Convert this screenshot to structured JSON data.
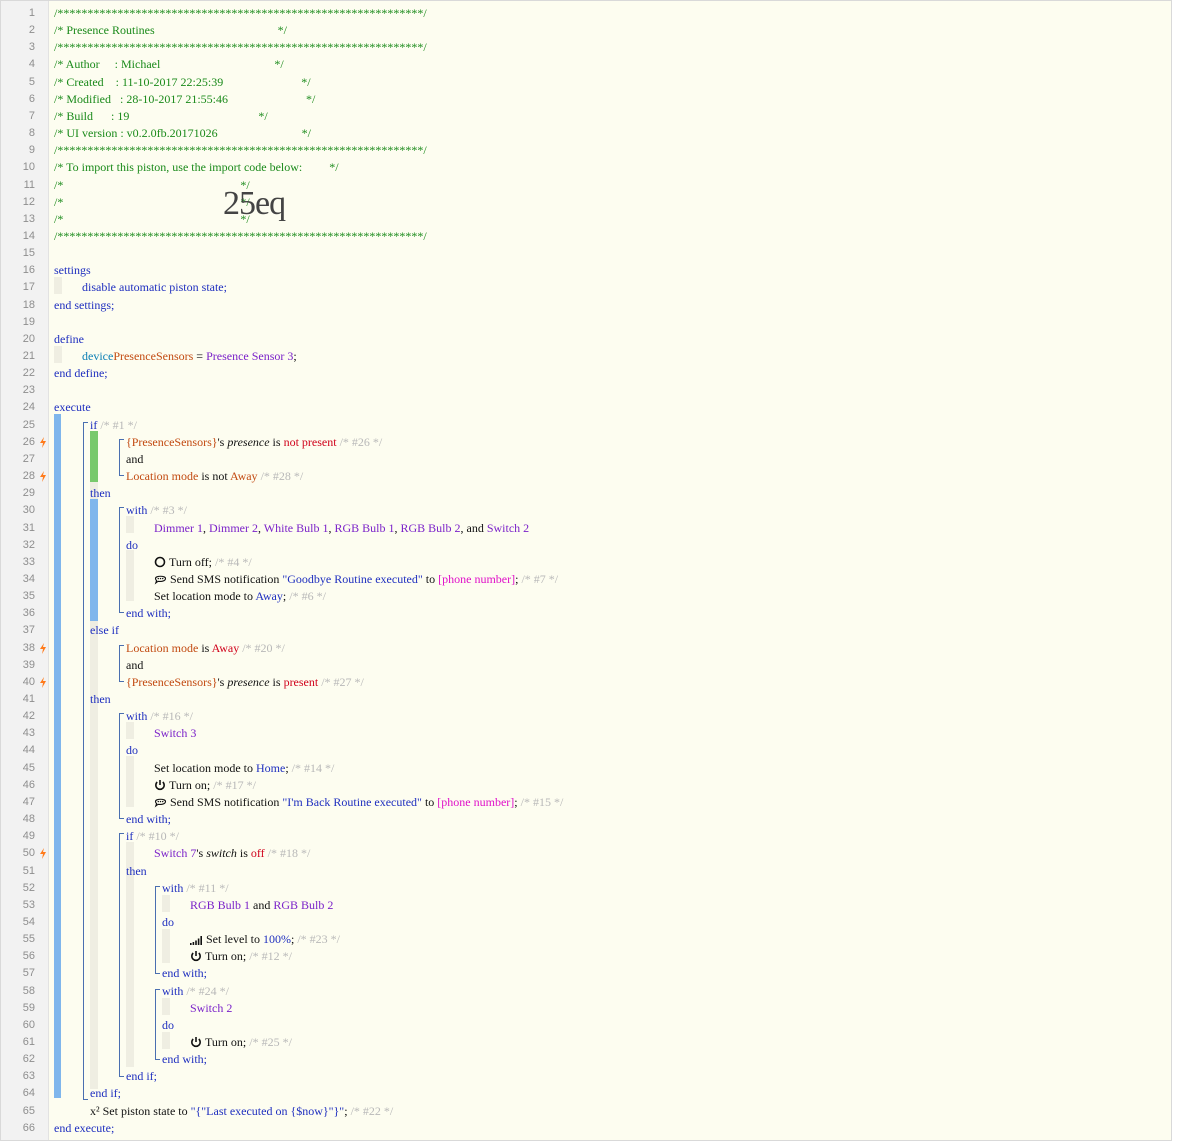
{
  "editor": {
    "lines": [
      "/*************************************************************/",
      "/* Presence Routines                                         */",
      "/*************************************************************/",
      "/* Author     : Michael                                      */",
      "/* Created    : 11-10-2017 22:25:39                          */",
      "/* Modified   : 28-10-2017 21:55:46                          */",
      "/* Build      : 19                                           */",
      "/* UI version : v0.2.0fb.20171026                            */",
      "/*************************************************************/",
      "/* To import this piston, use the import code below:         */",
      "/*                                                           */",
      "/*                                                           */",
      "/*                                                           */",
      "/*************************************************************/"
    ],
    "overlay_code": "25eq",
    "settings": {
      "open": "settings",
      "option": "disable automatic piston state;",
      "close": "end settings;"
    },
    "define": {
      "open": "define",
      "type": "device",
      "var": "PresenceSensors",
      "eq": " = ",
      "value": "Presence Sensor 3",
      "semi": ";",
      "close": "end define;"
    },
    "execute_open": "execute",
    "execute_close": "end execute;",
    "kw": {
      "if": "if",
      "then": "then",
      "else_if": "else if",
      "and": "and",
      "with": "with",
      "do": "do",
      "end_with": "end with;",
      "end_if": "end if;"
    },
    "c1": "/* #1 */",
    "c26": "/* #26 */",
    "c28": "/* #28 */",
    "c3": "/* #3 */",
    "c4": "/* #4 */",
    "c7": "/* #7 */",
    "c6": "/* #6 */",
    "c20": "/* #20 */",
    "c27": "/* #27 */",
    "c16": "/* #16 */",
    "c14": "/* #14 */",
    "c17": "/* #17 */",
    "c15": "/* #15 */",
    "c10": "/* #10 */",
    "c18": "/* #18 */",
    "c11": "/* #11 */",
    "c23": "/* #23 */",
    "c12": "/* #12 */",
    "c24": "/* #24 */",
    "c25": "/* #25 */",
    "c22": "/* #22 */",
    "cond1": {
      "dev": "{PresenceSensors}",
      "poss": "'s ",
      "attr": "presence",
      "is": " is ",
      "op": "not present"
    },
    "cond2": {
      "obj": "Location mode",
      "is": " is not ",
      "val": "Away"
    },
    "with1_devices": [
      {
        "name": "Dimmer 1",
        "sep": ", "
      },
      {
        "name": "Dimmer 2",
        "sep": ", "
      },
      {
        "name": "White Bulb 1",
        "sep": ", "
      },
      {
        "name": "RGB Bulb 1",
        "sep": ", "
      },
      {
        "name": "RGB Bulb 2",
        "sep": ", and "
      },
      {
        "name": "Switch 2",
        "sep": ""
      }
    ],
    "turn_off": "Turn off;",
    "sms1": {
      "pre": "Send SMS notification ",
      "msg": "\"Goodbye Routine executed\"",
      "to": " to ",
      "num": "[phone number]",
      "semi": ";"
    },
    "loc_away": {
      "pre": "Set location mode to ",
      "val": "Away",
      "semi": ";"
    },
    "cond3": {
      "obj": "Location mode",
      "is": " is ",
      "val": "Away"
    },
    "cond4": {
      "dev": "{PresenceSensors}",
      "poss": "'s ",
      "attr": "presence",
      "is": " is ",
      "op": "present"
    },
    "with2_device": "Switch 3",
    "loc_home": {
      "pre": "Set location mode to ",
      "val": "Home",
      "semi": ";"
    },
    "turn_on": "Turn on;",
    "sms2": {
      "pre": "Send SMS notification ",
      "msg": "\"I'm Back Routine executed\"",
      "to": " to ",
      "num": "[phone number]",
      "semi": ";"
    },
    "cond5": {
      "dev": "Switch 7",
      "poss": "'s ",
      "attr": "switch",
      "is": " is ",
      "val": "off"
    },
    "with3": {
      "d1": "RGB Bulb 1",
      "and": " and ",
      "d2": "RGB Bulb 2"
    },
    "set_level": {
      "pre": "Set level to ",
      "val": "100%",
      "semi": ";"
    },
    "with4_device": "Switch 2",
    "piston_state": {
      "icon": "x²",
      "pre": " Set piston state to ",
      "val": "\"{\"Last executed on {$now}\"}\"",
      "semi": ";"
    }
  },
  "colors": {
    "comment": "#1a8a1a",
    "keyword": "#1f2fbf",
    "device": "#7b22c9",
    "variable": "#c24a11",
    "operator_red": "#d0021b",
    "phone": "#e011c9",
    "grey_comment": "#b8b8b8",
    "bar_blue": "#7fb6ec",
    "bar_green": "#78c96c",
    "bar_beige": "#efeee2",
    "bolt": "#ff7a1a"
  },
  "icons": {
    "bolt": "lightning-icon",
    "power": "power-icon",
    "power_off": "power-off-icon",
    "sms": "speech-bubble-icon",
    "level": "signal-level-icon"
  }
}
